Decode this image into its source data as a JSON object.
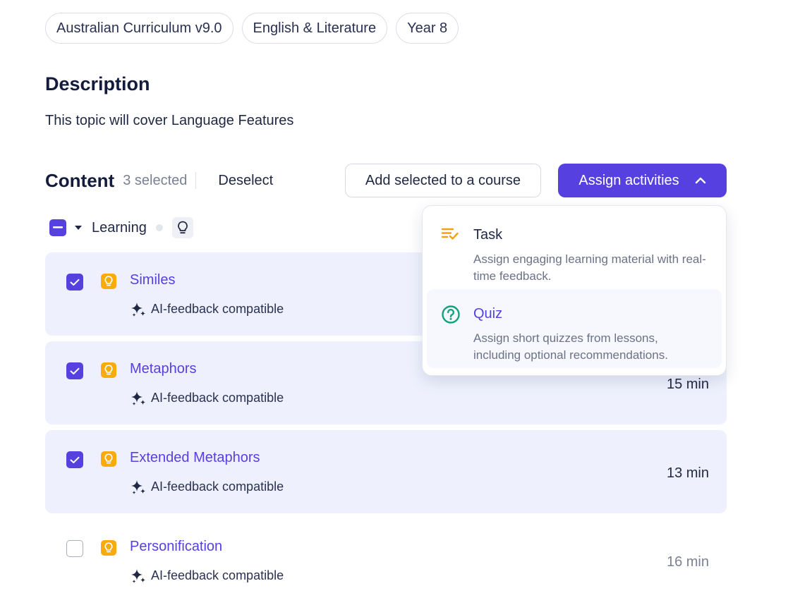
{
  "tags": [
    "Australian Curriculum v9.0",
    "English & Literature",
    "Year 8"
  ],
  "description": {
    "heading": "Description",
    "text": "This topic will cover Language Features"
  },
  "content": {
    "title": "Content",
    "selected_count": "3 selected",
    "deselect": "Deselect",
    "add_to_course": "Add selected to a course",
    "assign_activities": "Assign activities"
  },
  "group": {
    "label": "Learning",
    "icon": "lightbulb-icon"
  },
  "items": [
    {
      "title": "Similes",
      "ai_text": "AI-feedback compatible",
      "duration": "",
      "selected": true
    },
    {
      "title": "Metaphors",
      "ai_text": "AI-feedback compatible",
      "duration": "15 min",
      "selected": true
    },
    {
      "title": "Extended Metaphors",
      "ai_text": "AI-feedback compatible",
      "duration": "13 min",
      "selected": true
    },
    {
      "title": "Personification",
      "ai_text": "AI-feedback compatible",
      "duration": "16 min",
      "selected": false
    }
  ],
  "dropdown": {
    "options": [
      {
        "title": "Task",
        "description": "Assign engaging learning material with real-time feedback.",
        "icon": "task-list-check-icon"
      },
      {
        "title": "Quiz",
        "description": "Assign short quizzes from lessons, including optional recommendations.",
        "icon": "question-circle-icon"
      }
    ]
  },
  "colors": {
    "accent": "#5640e0",
    "badge": "#f9ab0d",
    "selected_row": "#eef1fd",
    "quiz_icon": "#13a37c"
  }
}
